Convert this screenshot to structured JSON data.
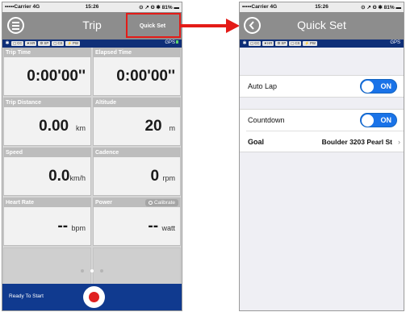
{
  "status": {
    "carrier": "•••••Carrier",
    "network": "4G",
    "time": "15:26",
    "right": "⊙ ↗ Θ ✱ 81% ▬"
  },
  "left_screen": {
    "title": "Trip",
    "quick_set_label": "Quick Set",
    "sensors": [
      "▢ CC",
      "♥ HR",
      "⚙ SP",
      "▢ CS",
      "⚡ PW"
    ],
    "gps_label": "GPS",
    "cells": [
      {
        "label": "Trip Time",
        "value": "0:00'00''",
        "unit": ""
      },
      {
        "label": "Elapsed Time",
        "value": "0:00'00''",
        "unit": ""
      },
      {
        "label": "Trip Distance",
        "value": "0.00",
        "unit": "km"
      },
      {
        "label": "Altitude",
        "value": "20",
        "unit": "m"
      },
      {
        "label": "Speed",
        "value": "0.0",
        "unit": "km/h"
      },
      {
        "label": "Cadence",
        "value": "0",
        "unit": "rpm"
      },
      {
        "label": "Heart Rate",
        "value": "--",
        "unit": "bpm"
      },
      {
        "label": "Power",
        "value": "--",
        "unit": "watt"
      }
    ],
    "calibrate_label": "Calibrate",
    "page_indicator": {
      "count": 3,
      "active": 1
    },
    "ready_label": "Ready To Start"
  },
  "right_screen": {
    "title": "Quick Set",
    "sensors": [
      "▢ CC",
      "♥ HR",
      "⚙ SP",
      "▢ CS",
      "⚡ PW"
    ],
    "gps_label": "GPS",
    "auto_lap": {
      "label": "Auto Lap",
      "state": "ON"
    },
    "countdown": {
      "label": "Countdown",
      "state": "ON"
    },
    "goal": {
      "label": "Goal",
      "value": "Boulder 3203 Pearl St"
    }
  },
  "colors": {
    "highlight": "#e41b17",
    "nav": "#8d8d8d",
    "sensor_bar": "#0f2f78",
    "bottom_bar": "#103a8f",
    "toggle_on": "#1a73e8",
    "record": "#e02020"
  }
}
